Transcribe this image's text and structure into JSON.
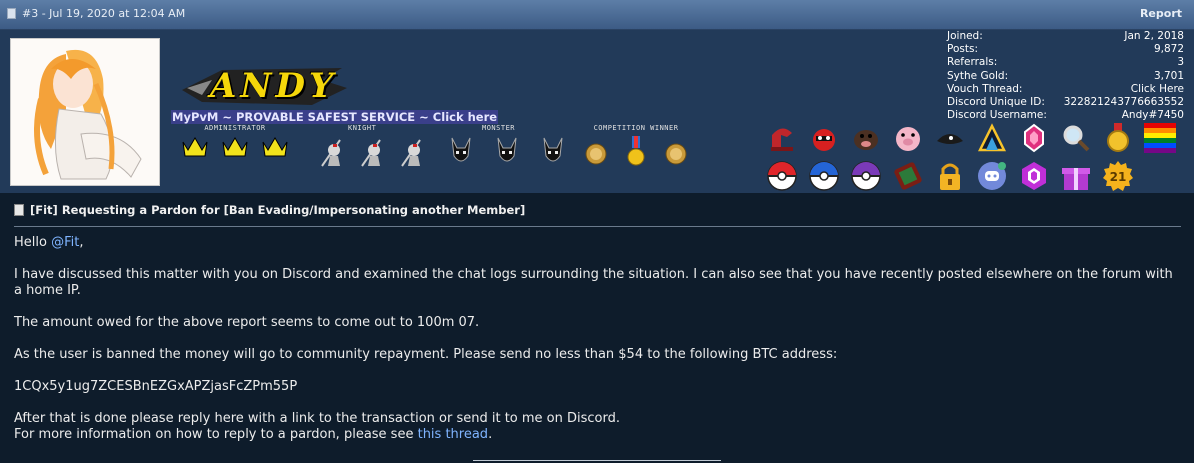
{
  "post_header": {
    "meta": "#3 - Jul 19, 2020 at 12:04 AM",
    "report_label": "Report"
  },
  "user": {
    "logo_text": "ANDY",
    "signature": "MyPvM ~ PROVABLE SAFEST SERVICE ~ Click here",
    "ranks": [
      {
        "name": "ADMINISTRATOR",
        "icon": "crown-icon",
        "count": 3
      },
      {
        "name": "KNIGHT",
        "icon": "knight-icon",
        "count": 3
      },
      {
        "name": "MONSTER",
        "icon": "monster-icon",
        "count": 3
      },
      {
        "name": "COMPETITION WINNER",
        "icon": "medal-icon",
        "count": 3
      }
    ],
    "stats": [
      {
        "label": "Joined:",
        "value": "Jan 2, 2018"
      },
      {
        "label": "Posts:",
        "value": "9,872"
      },
      {
        "label": "Referrals:",
        "value": "3"
      },
      {
        "label": "Sythe Gold:",
        "value": "3,701"
      },
      {
        "label": "Vouch Thread:",
        "value": "Click Here"
      },
      {
        "label": "Discord Unique ID:",
        "value": "322821243776663552"
      },
      {
        "label": "Discord Username:",
        "value": "Andy#7450"
      }
    ],
    "badges_row1": [
      "helmet-icon",
      "bomb-icon",
      "mole-icon",
      "pig-icon",
      "hat-icon",
      "crystal-icon",
      "gem-icon",
      "magnifier-icon",
      "gold-medal-icon",
      "rainbow-flag-icon"
    ],
    "badges_row2": [
      "pokeball-icon",
      "superball-icon",
      "masterball-icon",
      "phone-icon",
      "lock-icon",
      "discord-icon",
      "hexagon-icon",
      "gift-icon",
      "badge-21-icon"
    ],
    "badge_21_text": "21"
  },
  "post": {
    "title_prefix": "[Fit]",
    "title": "Requesting a Pardon for [Ban Evading/Impersonating another Member]",
    "greeting": "Hello ",
    "mention": "@Fit",
    "greeting_end": ",",
    "para1": "I have discussed this matter with you on Discord and examined the chat logs surrounding the situation. I can also see that you have recently posted elsewhere on the forum with a home IP.",
    "para2": "The amount owed for the above report seems to come out to 100m 07.",
    "para3": "As the user is banned the money will go to community repayment. Please send no less than $54 to the following BTC address:",
    "btc_address": "1CQx5y1ug7ZCESBnEZGxAPZjasFcZPm55P",
    "para4_line1": "After that is done please reply here with a link to the transaction or send it to me on Discord.",
    "para4_line2": "For more information on how to reply to a pardon, please see ",
    "link_text": "this thread",
    "para4_end": "."
  }
}
